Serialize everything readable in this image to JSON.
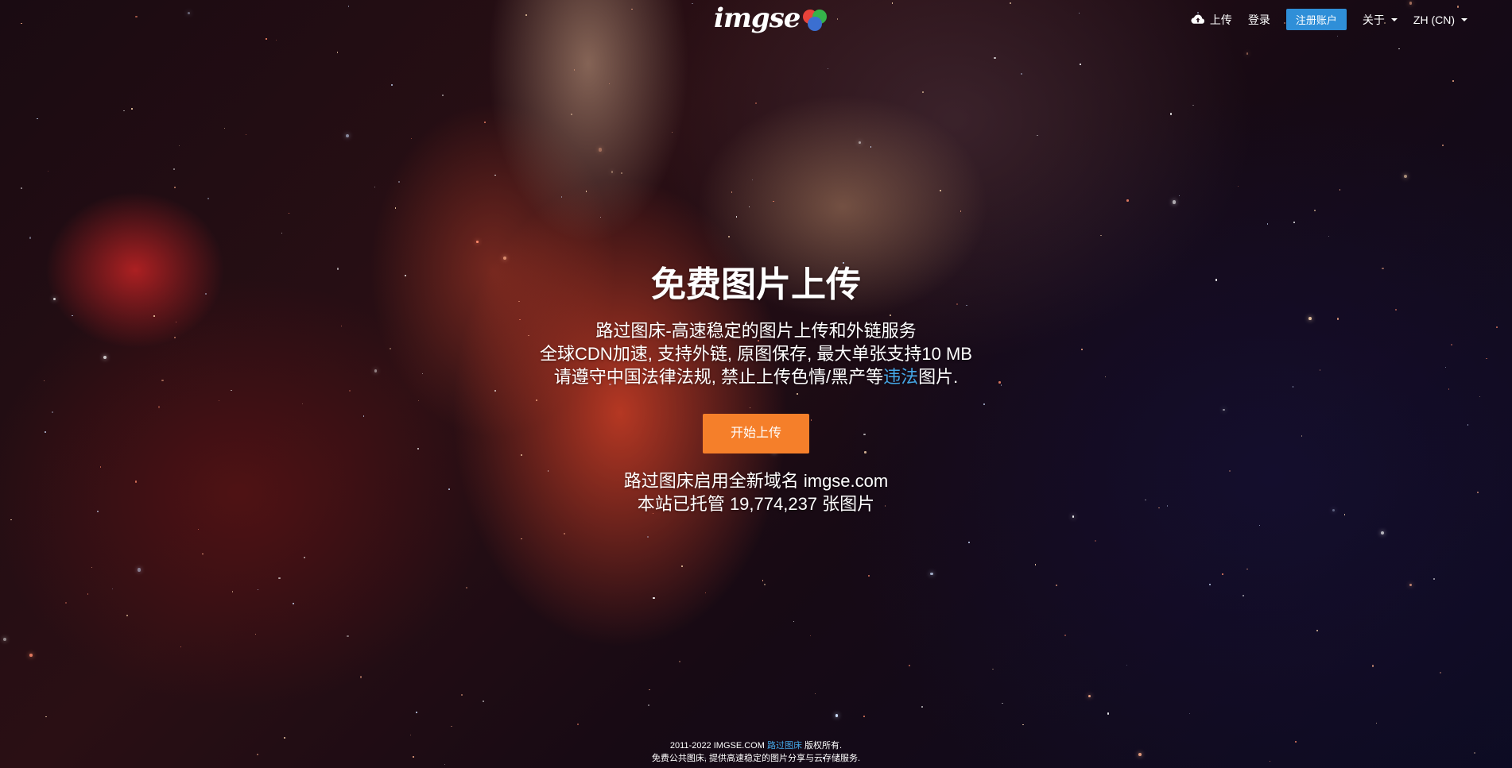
{
  "header": {
    "logo_text": "imgse",
    "nav": {
      "upload_label": "上传",
      "login_label": "登录",
      "signup_label": "注册账户",
      "about_label": "关于",
      "language_label": "ZH (CN)"
    }
  },
  "hero": {
    "title": "免费图片上传",
    "desc_line1": "路过图床-高速稳定的图片上传和外链服务",
    "desc_line2": "全球CDN加速, 支持外链, 原图保存, 最大单张支持10 MB",
    "desc_line3_prefix": "请遵守中国法律法规, 禁止上传色情/黑产等",
    "desc_line3_link": "违法",
    "desc_line3_suffix": "图片.",
    "start_button_label": "开始上传",
    "domain_notice": "路过图床启用全新域名 imgse.com",
    "hosted_prefix": "本站已托管",
    "hosted_count": "19,774,237",
    "hosted_suffix": "张图片"
  },
  "footer": {
    "copyright_prefix": "2011-2022 IMGSE.COM",
    "copyright_link": "路过图床",
    "copyright_suffix": "版权所有.",
    "tagline": "免费公共图床, 提供高速稳定的图片分享与云存储服务."
  },
  "colors": {
    "accent_orange": "#f57f2a",
    "signup_blue": "#2f8fd8",
    "link_blue": "#45a7e6"
  }
}
